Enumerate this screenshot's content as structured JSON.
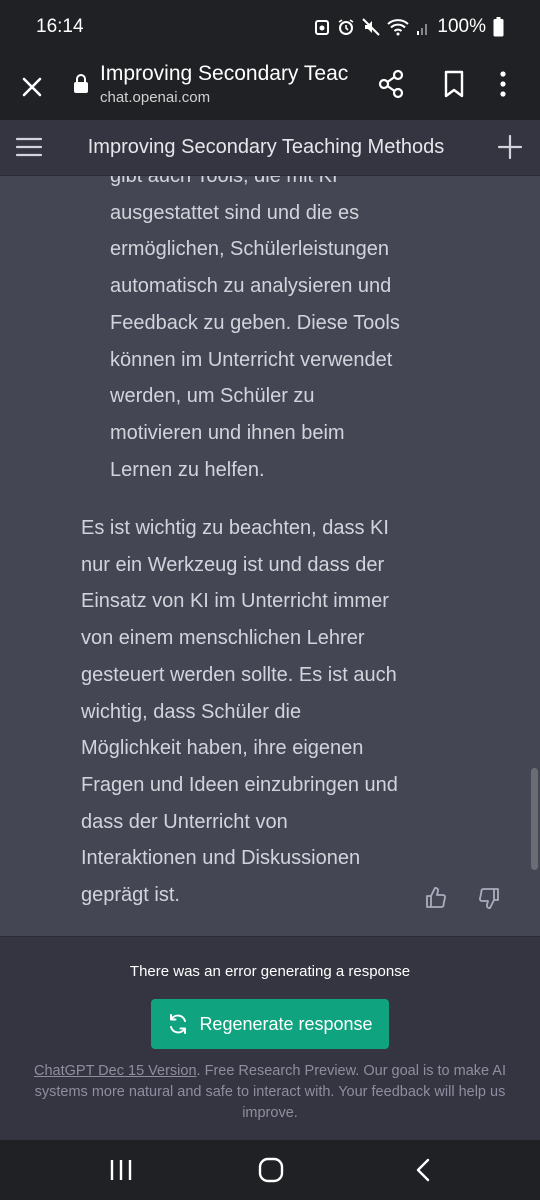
{
  "status_bar": {
    "time": "16:14",
    "battery": "100%"
  },
  "browser": {
    "title": "Improving Secondary Teac…",
    "url": "chat.openai.com"
  },
  "header": {
    "title": "Improving Secondary Teaching Methods"
  },
  "conversation": {
    "paragraph_1_lines": [
      "gibt auch Tools, die mit KI",
      "ausgestattet sind und die es",
      "ermöglichen, Schülerleistungen",
      "automatisch zu analysieren und",
      "Feedback zu geben. Diese Tools",
      "können im Unterricht verwendet",
      "werden, um Schüler zu",
      "motivieren und ihnen beim",
      "Lernen zu helfen."
    ],
    "paragraph_2_lines": [
      "Es ist wichtig zu beachten, dass KI",
      "nur ein Werkzeug ist und dass der",
      "Einsatz von KI im Unterricht immer",
      "von einem menschlichen Lehrer",
      "gesteuert werden sollte. Es ist auch",
      "wichtig, dass Schüler die",
      "Möglichkeit haben, ihre eigenen",
      "Fragen und Ideen einzubringen und",
      "dass der Unterricht von",
      "Interaktionen und Diskussionen",
      "geprägt ist."
    ]
  },
  "footer": {
    "error_text": "There was an error generating a response",
    "regenerate_label": "Regenerate response",
    "version_link": "ChatGPT Dec 15 Version",
    "disclaimer": ". Free Research Preview. Our goal is to make AI systems more natural and safe to interact with. Your feedback will help us improve."
  },
  "colors": {
    "message_bg": "#444654",
    "header_bg": "#343541",
    "browser_bg": "#202124",
    "accent": "#10a37f",
    "text": "#d1d5db",
    "muted": "#8e8ea0"
  },
  "icons": {
    "browser": [
      "close-icon",
      "lock-icon",
      "share-icon",
      "bookmark-icon",
      "more-vert-icon"
    ],
    "header": [
      "hamburger-menu-icon",
      "plus-icon"
    ],
    "feedback": [
      "thumbs-up-icon",
      "thumbs-down-icon"
    ],
    "nav": [
      "recent-apps-icon",
      "home-icon",
      "back-icon"
    ]
  }
}
